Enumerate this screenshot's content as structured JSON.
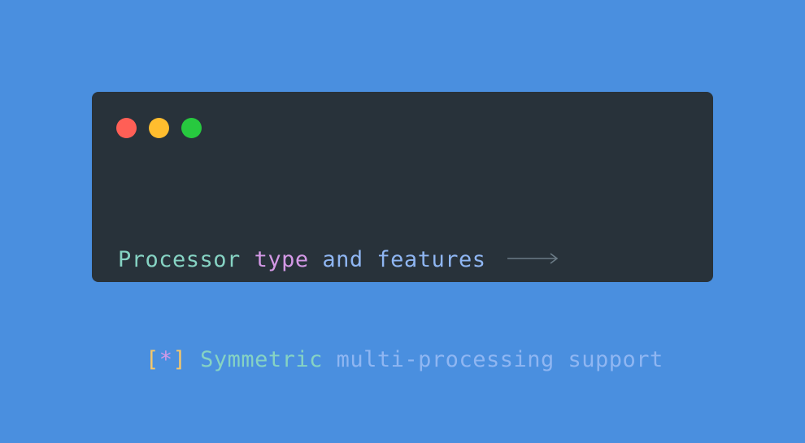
{
  "window": {
    "controls": {
      "close": "close-dot",
      "minimize": "minimize-dot",
      "maximize": "maximize-dot"
    }
  },
  "code": {
    "line1": {
      "word1": "Processor",
      "word2": "type",
      "word3": "and",
      "word4": "features",
      "arrow_icon": "long-right-arrow"
    },
    "line2": {
      "open_bracket": "[",
      "star": "*",
      "close_bracket": "]",
      "word1": "Symmetric",
      "word2": "multi-processing",
      "word3": "support"
    }
  },
  "colors": {
    "background": "#4a8fdf",
    "window": "#28323a",
    "teal": "#86d3c3",
    "purple": "#d499e6",
    "blue": "#8fb6f2",
    "yellow": "#f5c86a"
  }
}
